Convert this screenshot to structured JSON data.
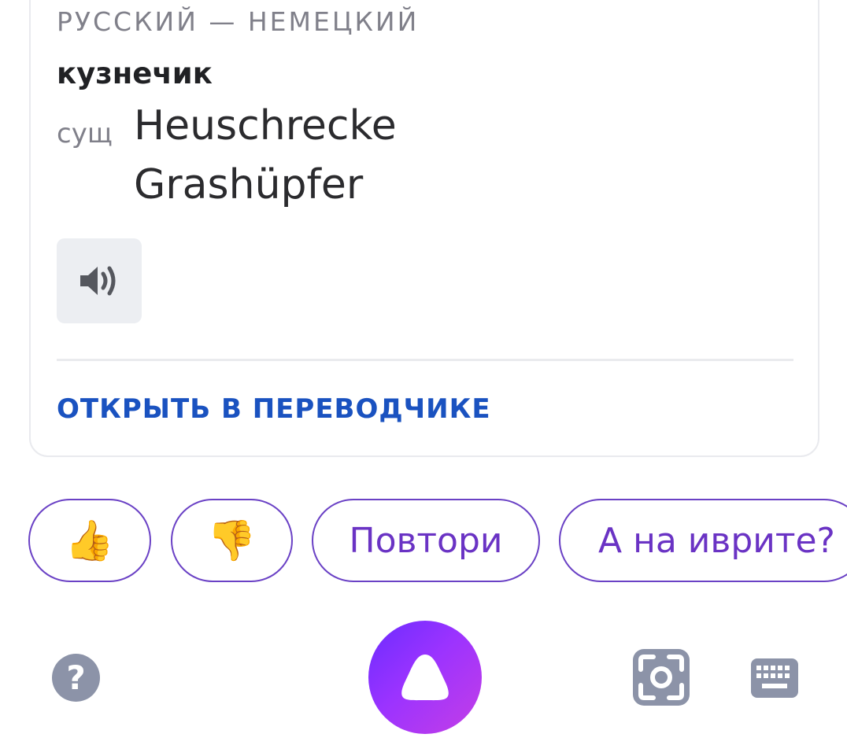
{
  "translation_card": {
    "language_pair": "РУССКИЙ — НЕМЕЦКИЙ",
    "source_word": "кузнечик",
    "part_of_speech": "сущ",
    "translations": [
      "Heuschrecke",
      "Grashüpfer"
    ],
    "speaker_icon": "speaker-icon",
    "open_in_translator": "ОТКРЫТЬ В ПЕРЕВОДЧИКЕ"
  },
  "suggestions": {
    "like_emoji": "👍",
    "dislike_emoji": "👎",
    "repeat": "Повтори",
    "in_hebrew": "А на иврите?"
  },
  "bottom_bar": {
    "help_glyph": "?",
    "help_icon": "question-icon",
    "assistant_icon": "alice-icon",
    "camera_icon": "camera-scan-icon",
    "keyboard_icon": "keyboard-icon"
  },
  "colors": {
    "accent_purple": "#6a33c4",
    "link_blue": "#1a52c0",
    "icon_gray": "#8c93a8"
  }
}
